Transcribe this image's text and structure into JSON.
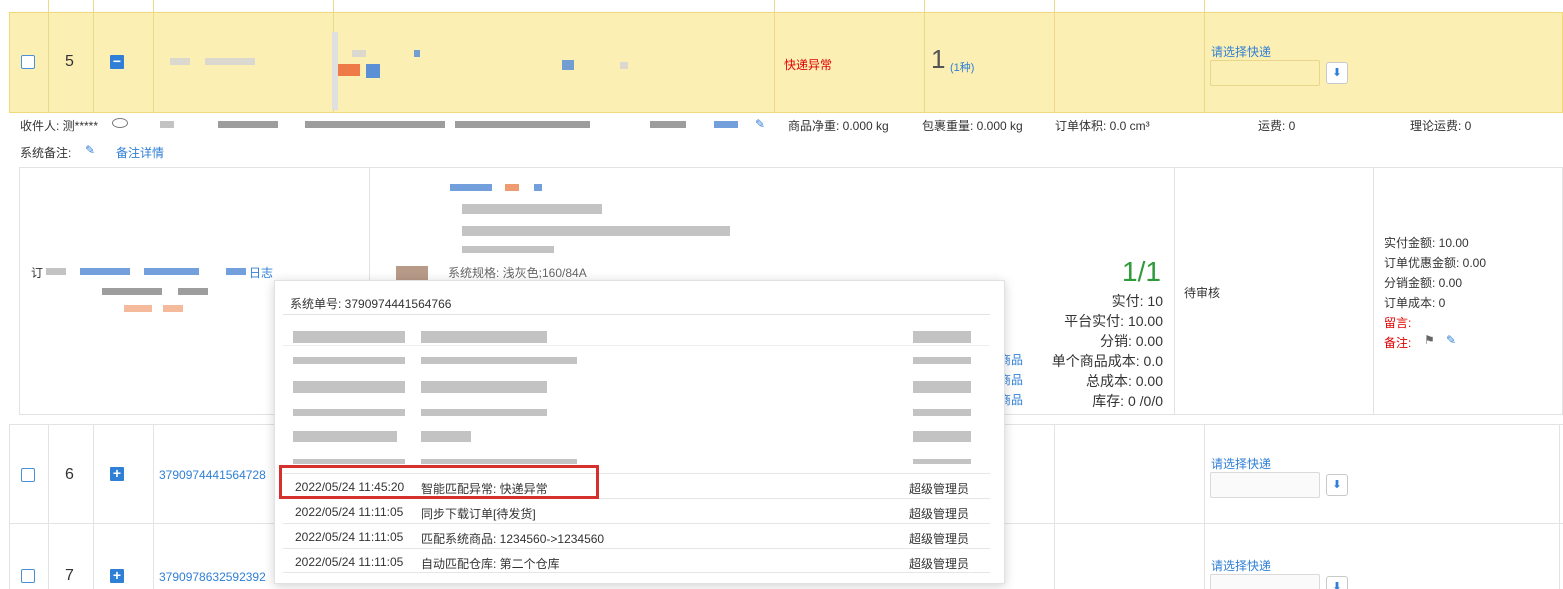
{
  "row5": {
    "number": "5",
    "status": "快递异常",
    "qty": "1",
    "qty_kind": "(1种)",
    "courier_placeholder": "请选择快递",
    "recipient_label": "收件人: 测*****",
    "net_weight": "商品净重: 0.000 kg",
    "pkg_weight": "包裹重量: 0.000 kg",
    "volume": "订单体积: 0.0 cm³",
    "freight": "运费:  0",
    "theory_freight": "理论运费:  0",
    "sys_note_label": "系统备注:",
    "note_detail": "备注详情",
    "spec": "系统规格: 浅灰色;160/84A",
    "ratio": "1/1",
    "paid": "实付: 10",
    "platform_paid": "平台实付: 10.00",
    "distribution": "分销: 0.00",
    "unit_cost": "单个商品成本: 0.0",
    "total_cost": "总成本: 0.00",
    "stock": "库存: 0 /0/0",
    "review_status": "待审核",
    "actual_amount": "实付金额: 10.00",
    "discount_amount": "订单优惠金额: 0.00",
    "distribution_amount": "分销金额: 0.00",
    "order_cost": "订单成本: 0",
    "message_label": "留言:",
    "remark_label": "备注:",
    "log_link": "日志",
    "order_prefix": "订",
    "product_link_a": "商品",
    "product_link_b": "商品",
    "product_link_c": "商品"
  },
  "row6": {
    "number": "6",
    "order_no": "3790974441564728",
    "courier_placeholder": "请选择快递"
  },
  "row7": {
    "number": "7",
    "order_no": "3790978632592392",
    "courier_placeholder": "请选择快递"
  },
  "popup": {
    "system_order": "系统单号: 3790974441564766",
    "logs": [
      {
        "time": "2022/05/24 11:45:20",
        "action": "智能匹配异常: 快递异常",
        "user": "超级管理员"
      },
      {
        "time": "2022/05/24 11:11:05",
        "action": "同步下载订单[待发货]",
        "user": "超级管理员"
      },
      {
        "time": "2022/05/24 11:11:05",
        "action": "匹配系统商品: 1234560->1234560",
        "user": "超级管理员"
      },
      {
        "time": "2022/05/24 11:11:05",
        "action": "自动匹配仓库: 第二个仓库",
        "user": "超级管理员"
      }
    ]
  },
  "colors": {
    "highlight_row": "#fcefb4",
    "accent_blue": "#2f7fd6",
    "ratio_green": "#2e9a3a",
    "alert_red": "#e00000",
    "annotation_box": "#d6302c"
  }
}
